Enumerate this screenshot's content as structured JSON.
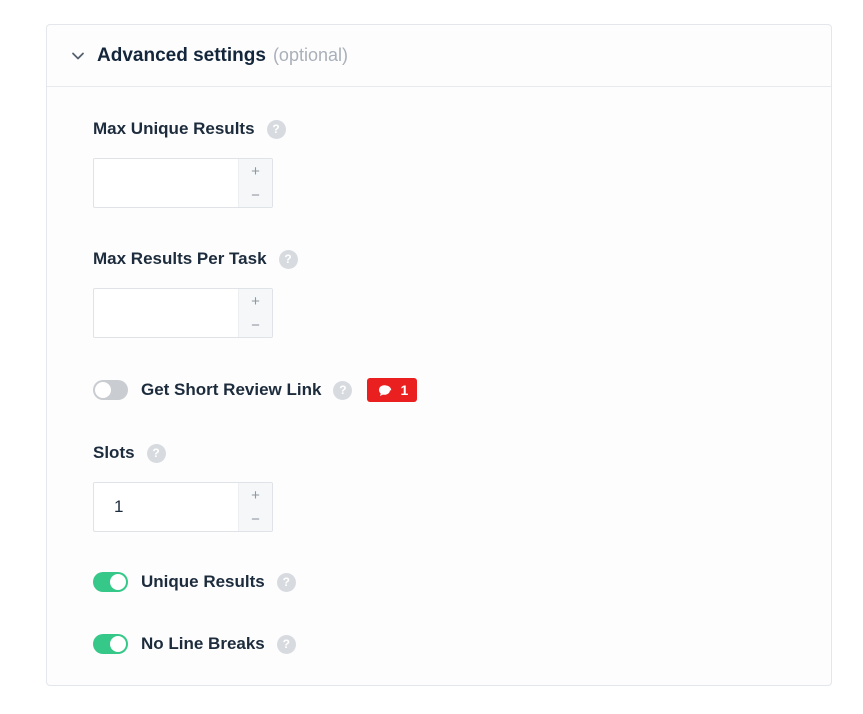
{
  "header": {
    "title": "Advanced settings",
    "optional": "(optional)",
    "chevron_icon": "chevron-down-icon"
  },
  "fields": {
    "max_unique_results": {
      "label": "Max Unique Results",
      "value": ""
    },
    "max_results_per_task": {
      "label": "Max Results Per Task",
      "value": ""
    },
    "slots": {
      "label": "Slots",
      "value": "1"
    }
  },
  "stepper": {
    "plus": "+",
    "minus": "−"
  },
  "help_glyph": "?",
  "toggles": {
    "get_short_review_link": {
      "label": "Get Short Review Link",
      "on": false,
      "badge_count": "1",
      "badge_icon": "comment-icon"
    },
    "unique_results": {
      "label": "Unique Results",
      "on": true
    },
    "no_line_breaks": {
      "label": "No Line Breaks",
      "on": true
    }
  },
  "colors": {
    "toggle_on": "#36c889",
    "toggle_off": "#c9ccd1",
    "badge": "#ea1f1f",
    "help": "#d7dbe0"
  }
}
